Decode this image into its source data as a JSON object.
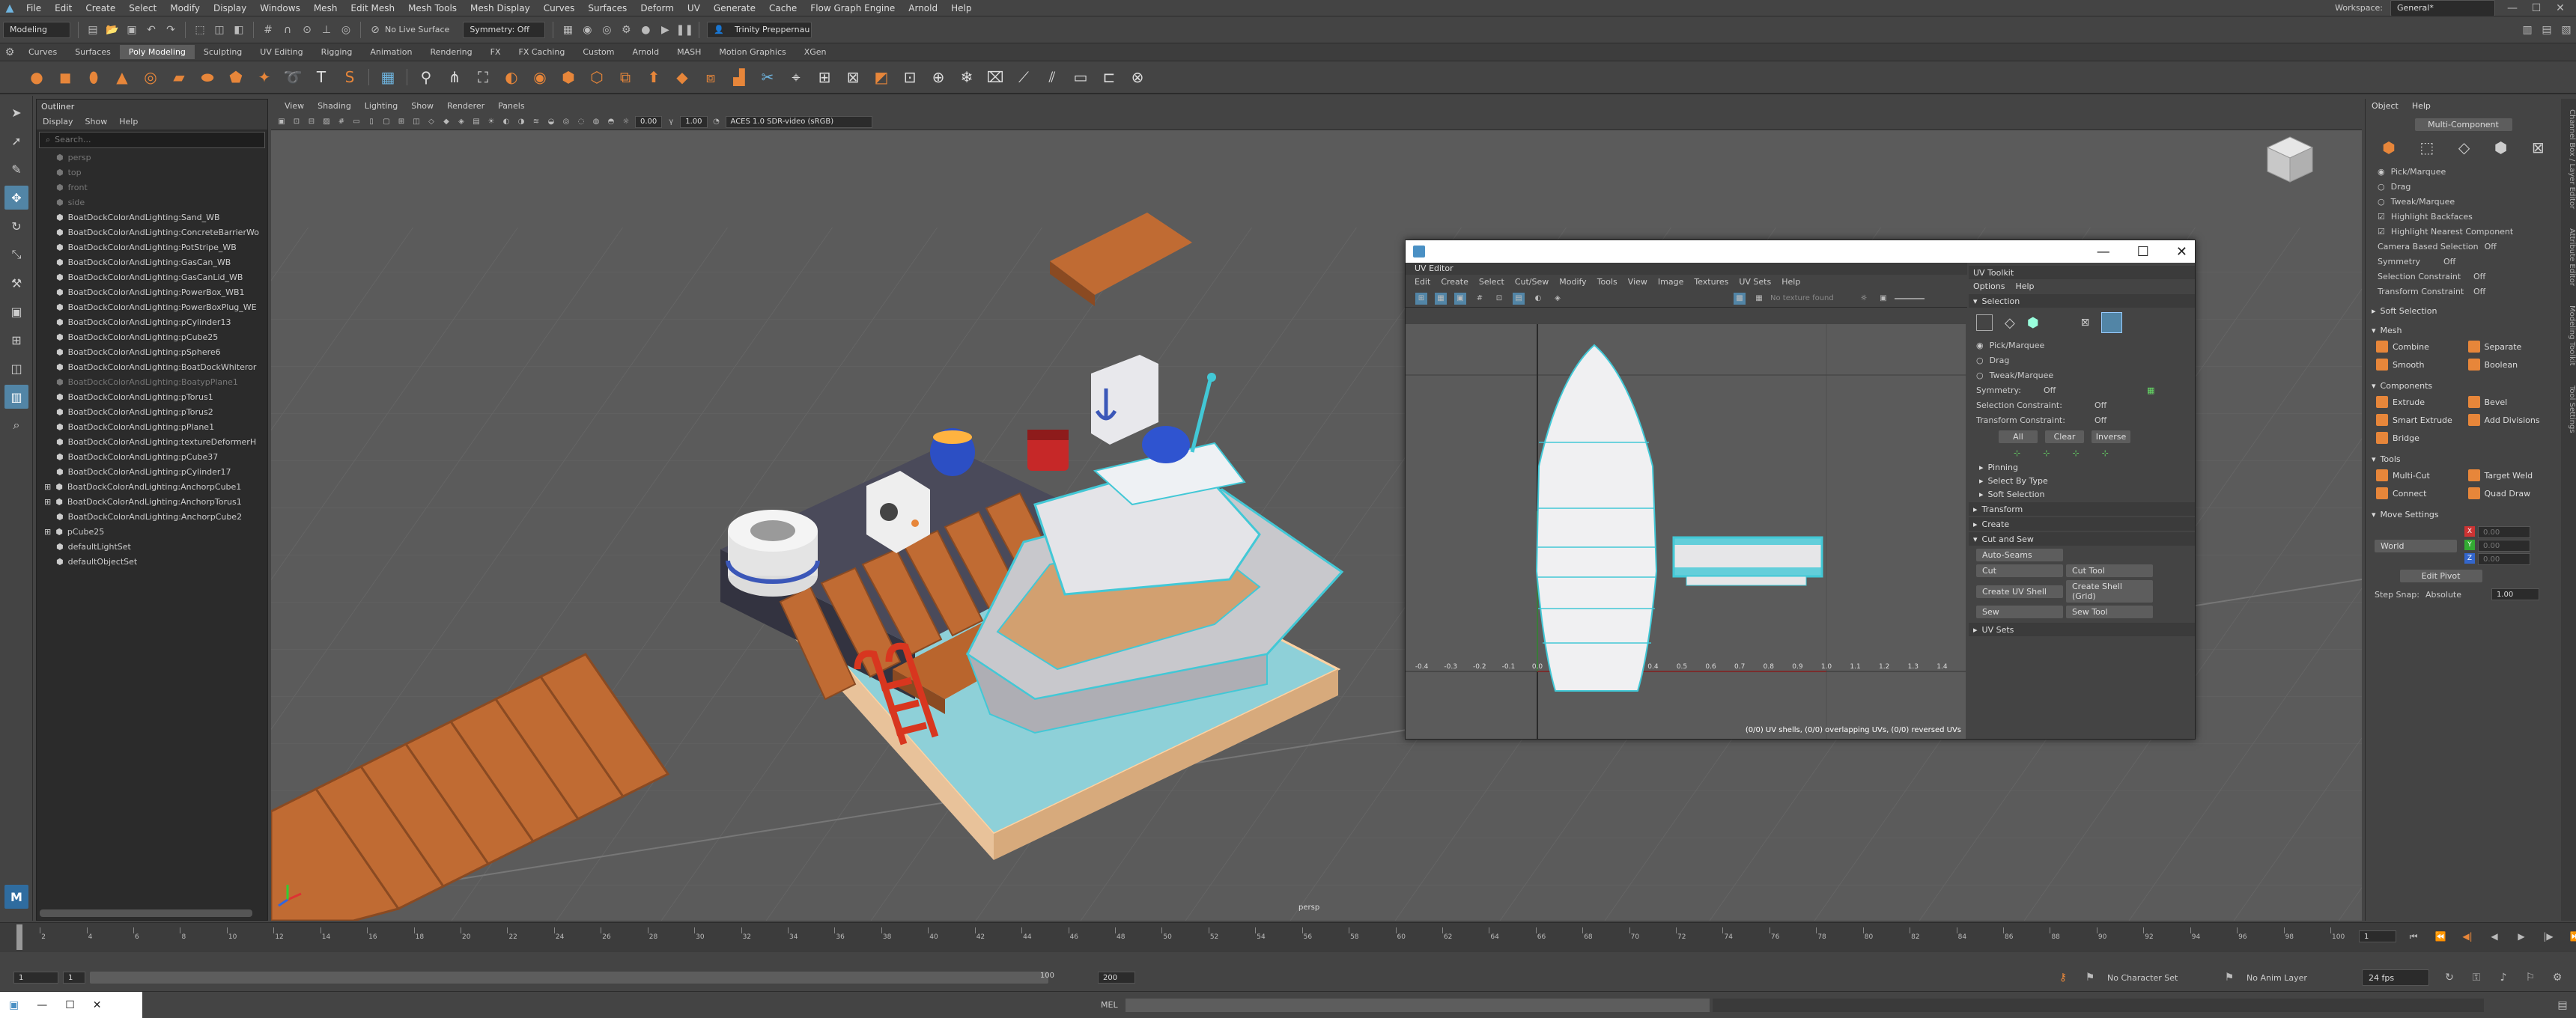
{
  "menubar": {
    "items": [
      "File",
      "Edit",
      "Create",
      "Select",
      "Modify",
      "Display",
      "Windows",
      "Mesh",
      "Edit Mesh",
      "Mesh Tools",
      "Mesh Display",
      "Curves",
      "Surfaces",
      "Deform",
      "UV",
      "Generate",
      "Cache",
      "Flow Graph Engine",
      "Arnold",
      "Help"
    ],
    "workspace_label": "Workspace:",
    "workspace_value": "General*"
  },
  "statusline": {
    "mode": "Modeling",
    "live_surface": "No Live Surface",
    "symmetry": "Symmetry: Off",
    "user": "Trinity Preppernau"
  },
  "shelf": {
    "tabs": [
      "Curves",
      "Surfaces",
      "Poly Modeling",
      "Sculpting",
      "UV Editing",
      "Rigging",
      "Animation",
      "Rendering",
      "FX",
      "FX Caching",
      "Custom",
      "Arnold",
      "MASH",
      "Motion Graphics",
      "XGen"
    ],
    "active_tab": "Poly Modeling"
  },
  "outliner": {
    "title": "Outliner",
    "menu": [
      "Display",
      "Show",
      "Help"
    ],
    "search_placeholder": "Search...",
    "items": [
      {
        "label": "persp",
        "dim": true
      },
      {
        "label": "top",
        "dim": true
      },
      {
        "label": "front",
        "dim": true
      },
      {
        "label": "side",
        "dim": true
      },
      {
        "label": "BoatDockColorAndLighting:Sand_WB"
      },
      {
        "label": "BoatDockColorAndLighting:ConcreteBarrierWo"
      },
      {
        "label": "BoatDockColorAndLighting:PotStripe_WB"
      },
      {
        "label": "BoatDockColorAndLighting:GasCan_WB"
      },
      {
        "label": "BoatDockColorAndLighting:GasCanLid_WB"
      },
      {
        "label": "BoatDockColorAndLighting:PowerBox_WB1"
      },
      {
        "label": "BoatDockColorAndLighting:PowerBoxPlug_WE"
      },
      {
        "label": "BoatDockColorAndLighting:pCylinder13"
      },
      {
        "label": "BoatDockColorAndLighting:pCube25"
      },
      {
        "label": "BoatDockColorAndLighting:pSphere6"
      },
      {
        "label": "BoatDockColorAndLighting:BoatDockWhiteror"
      },
      {
        "label": "BoatDockColorAndLighting:BoatypPlane1",
        "dim": true
      },
      {
        "label": "BoatDockColorAndLighting:pTorus1"
      },
      {
        "label": "BoatDockColorAndLighting:pTorus2"
      },
      {
        "label": "BoatDockColorAndLighting:pPlane1"
      },
      {
        "label": "BoatDockColorAndLighting:textureDeformerH"
      },
      {
        "label": "BoatDockColorAndLighting:pCube37"
      },
      {
        "label": "BoatDockColorAndLighting:pCylinder17"
      },
      {
        "label": "BoatDockColorAndLighting:AnchorpCube1",
        "exp": true
      },
      {
        "label": "BoatDockColorAndLighting:AnchorpTorus1",
        "exp": true
      },
      {
        "label": "BoatDockColorAndLighting:AnchorpCube2"
      },
      {
        "label": "pCube25",
        "exp": true
      },
      {
        "label": "defaultLightSet"
      },
      {
        "label": "defaultObjectSet"
      }
    ]
  },
  "viewport": {
    "menu": [
      "View",
      "Shading",
      "Lighting",
      "Show",
      "Renderer",
      "Panels"
    ],
    "exposure": "0.00",
    "gamma": "1.00",
    "color_space": "ACES 1.0 SDR-video (sRGB)",
    "camera_label": "persp"
  },
  "uv_editor": {
    "window_title": "",
    "panel_label": "UV Editor",
    "menu": [
      "Edit",
      "Create",
      "Select",
      "Cut/Sew",
      "Modify",
      "Tools",
      "View",
      "Image",
      "Textures",
      "UV Sets",
      "Help"
    ],
    "texture_placeholder": "No texture found",
    "status": "(0/0) UV shells, (0/0) overlapping UVs, (0/0) reversed UVs",
    "u_ticks": [
      "-0.4",
      "-0.3",
      "-0.2",
      "-0.1",
      "0.0",
      "0.1",
      "0.2",
      "0.3",
      "0.4",
      "0.5",
      "0.6",
      "0.7",
      "0.8",
      "0.9",
      "1.0",
      "1.1",
      "1.2",
      "1.3",
      "1.4"
    ]
  },
  "uv_toolkit": {
    "title": "UV Toolkit",
    "menu": [
      "Options",
      "Help"
    ],
    "selection_header": "Selection",
    "modes": [
      "Pick/Marquee",
      "Drag",
      "Tweak/Marquee"
    ],
    "symmetry_label": "Symmetry:",
    "symmetry_value": "Off",
    "sel_constraint_label": "Selection Constraint:",
    "sel_constraint_value": "Off",
    "transform_constraint_label": "Transform Constraint:",
    "transform_constraint_value": "Off",
    "buttons": [
      "All",
      "Clear",
      "Inverse"
    ],
    "sections": [
      "Pinning",
      "Select By Type",
      "Soft Selection",
      "Transform",
      "Create",
      "Cut and Sew"
    ],
    "auto_seams": "Auto-Seams",
    "cut": "Cut",
    "cut_tool": "Cut Tool",
    "create_uv_shell": "Create UV Shell",
    "create_shell_grid": "Create Shell (Grid)",
    "sew": "Sew",
    "sew_tool": "Sew Tool",
    "uv_sets": "UV Sets"
  },
  "modeling_toolkit": {
    "menu": [
      "Object",
      "Help"
    ],
    "multi_component": "Multi-Component",
    "options": [
      "Pick/Marquee",
      "Drag",
      "Tweak/Marquee",
      "Highlight Backfaces",
      "Highlight Nearest Component"
    ],
    "camera_based": "Camera Based Selection",
    "camera_based_value": "Off",
    "symmetry": "Symmetry",
    "symmetry_value": "Off",
    "selection_constraint": "Selection Constraint",
    "selection_constraint_value": "Off",
    "transform_constraint": "Transform Constraint",
    "transform_constraint_value": "Off",
    "soft_selection": "Soft Selection",
    "mesh_header": "Mesh",
    "mesh_buttons": [
      "Combine",
      "Separate",
      "Smooth",
      "Boolean"
    ],
    "components_header": "Components",
    "component_buttons": [
      "Extrude",
      "Bevel",
      "Smart Extrude",
      "Add Divisions",
      "Bridge"
    ],
    "tools_header": "Tools",
    "tool_buttons": [
      "Multi-Cut",
      "Target Weld",
      "Connect",
      "Quad Draw"
    ],
    "move_settings": "Move Settings",
    "world": "World",
    "xyz_values": [
      "0.00",
      "0.00",
      "0.00"
    ],
    "edit_pivot": "Edit Pivot",
    "step_snap": "Step Snap:",
    "step_snap_mode": "Absolute",
    "step_snap_value": "1.00"
  },
  "right_tabs": [
    "Channel Box / Layer Editor",
    "Attribute Editor",
    "Modeling Toolkit",
    "Tool Settings"
  ],
  "timeline": {
    "ticks": [
      "1",
      "2",
      "4",
      "6",
      "8",
      "10",
      "12",
      "14",
      "16",
      "18",
      "20",
      "22",
      "24",
      "26",
      "28",
      "30",
      "32",
      "34",
      "36",
      "38",
      "40",
      "42",
      "44",
      "46",
      "48",
      "50",
      "52",
      "54",
      "56",
      "58",
      "60",
      "62",
      "64",
      "66",
      "68",
      "70",
      "72",
      "74",
      "76",
      "78",
      "80",
      "82",
      "84",
      "86",
      "88",
      "90",
      "92",
      "94",
      "96",
      "98",
      "100"
    ],
    "current_frame": "1"
  },
  "range": {
    "start": "1",
    "range_start": "1",
    "range_end": "100",
    "end": "200",
    "character_set": "No Character Set",
    "anim_layer": "No Anim Layer",
    "fps": "24 fps"
  },
  "cmdline": {
    "label": "MEL"
  },
  "colors": {
    "accent": "#e7863a",
    "selection": "#5285a6",
    "uv_cyan": "#42c8d6",
    "wood": "#bf6b33"
  }
}
